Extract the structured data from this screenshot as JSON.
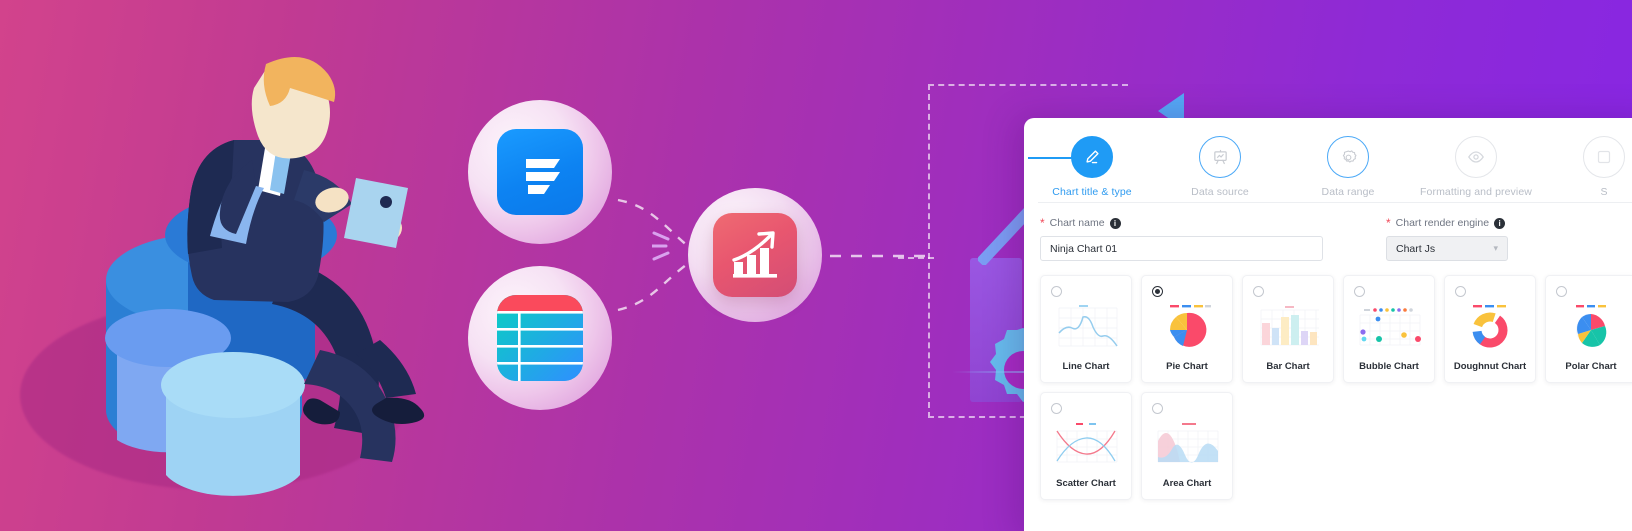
{
  "theme": {
    "bg_gradient_from": "#d2438c",
    "bg_gradient_to": "#8726e4",
    "accent_blue": "#1f9bf5",
    "required_red": "#f04b5a",
    "panel_bg": "#ffffff"
  },
  "illustration": {
    "name": "businessman-on-pie-chart",
    "alt": "Man in suit holding tablet seated on a 3D pie chart"
  },
  "flow": {
    "source_icons": [
      {
        "name": "fluent-forms-icon",
        "label": "Fluent Forms"
      },
      {
        "name": "data-table-icon",
        "label": "Data Table"
      }
    ],
    "target_icon": {
      "name": "bar-chart-growth-icon",
      "label": "Charts"
    }
  },
  "panel": {
    "steps": [
      {
        "label": "Chart title & type",
        "icon": "pencil-icon",
        "state": "active"
      },
      {
        "label": "Data source",
        "icon": "presentation-board-icon",
        "state": "ready"
      },
      {
        "label": "Data range",
        "icon": "gear-icon",
        "state": "ready"
      },
      {
        "label": "Formatting and preview",
        "icon": "eye-icon",
        "state": "pending"
      },
      {
        "label": "S",
        "icon": "save-icon",
        "state": "pending"
      }
    ],
    "fields": {
      "chart_name": {
        "label": "Chart name",
        "required": true,
        "value": "Ninja Chart 01",
        "placeholder": "Chart name"
      },
      "render_engine": {
        "label": "Chart render engine",
        "required": true,
        "value": "Chart Js",
        "options": [
          "Chart Js"
        ]
      }
    },
    "chart_types": [
      {
        "label": "Line Chart",
        "thumb": "line-chart-thumb",
        "selected": false
      },
      {
        "label": "Pie Chart",
        "thumb": "pie-chart-thumb",
        "selected": true
      },
      {
        "label": "Bar Chart",
        "thumb": "bar-chart-thumb",
        "selected": false
      },
      {
        "label": "Bubble Chart",
        "thumb": "bubble-chart-thumb",
        "selected": false
      },
      {
        "label": "Doughnut Chart",
        "thumb": "doughnut-chart-thumb",
        "selected": false
      },
      {
        "label": "Polar Chart",
        "thumb": "polar-chart-thumb",
        "selected": false
      },
      {
        "label": "Scatter Chart",
        "thumb": "scatter-chart-thumb",
        "selected": false
      },
      {
        "label": "Area Chart",
        "thumb": "area-chart-thumb",
        "selected": false
      }
    ]
  }
}
